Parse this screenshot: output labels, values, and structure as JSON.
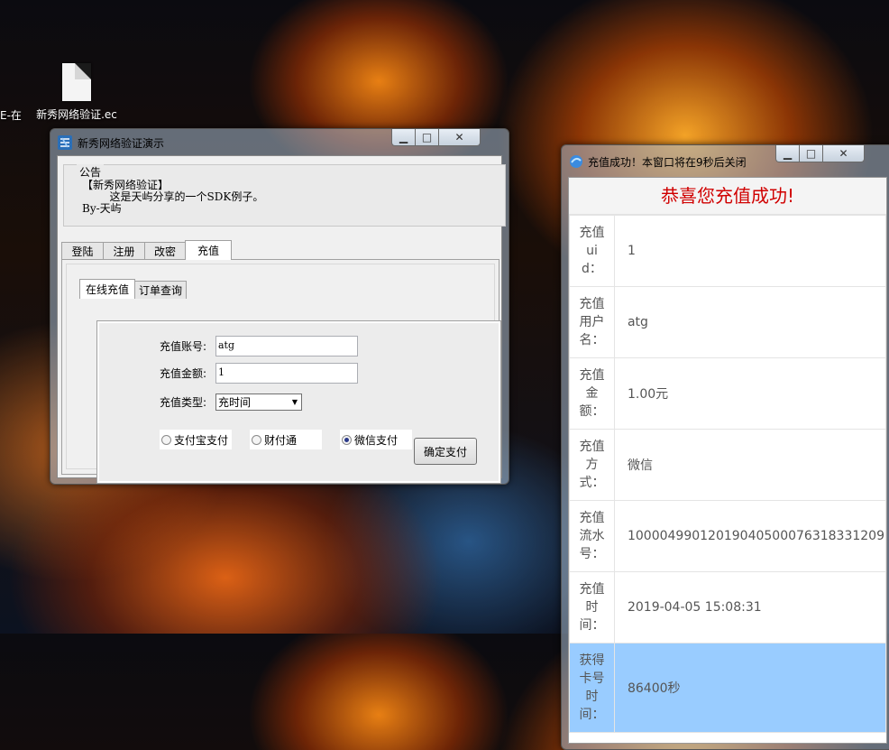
{
  "desktop": {
    "icon_label": "新秀网络验证.ec",
    "left_partial_label": "E-在"
  },
  "left_window": {
    "title": "新秀网络验证演示",
    "notice": {
      "legend": "公告",
      "text": "【新秀网络验证】\n        这是天屿分享的一个SDK例子。\nBy-天屿"
    },
    "tabs": [
      "登陆",
      "注册",
      "改密",
      "充值"
    ],
    "active_tab": "充值",
    "sub_tabs": [
      "在线充值",
      "订单查询"
    ],
    "active_sub_tab": "在线充值",
    "form": {
      "account_label": "充值账号:",
      "account_value": "atg",
      "amount_label": "充值金额:",
      "amount_value": "1",
      "type_label": "充值类型:",
      "type_value": "充时间"
    },
    "payment_options": [
      {
        "label": "支付宝支付",
        "selected": false
      },
      {
        "label": "财付通",
        "selected": false
      },
      {
        "label": "微信支付",
        "selected": true
      }
    ],
    "confirm_button": "确定支付"
  },
  "right_window": {
    "title": "充值成功！本窗口将在9秒后关闭",
    "heading": "恭喜您充值成功!",
    "heading_color": "#d00000",
    "rows": [
      {
        "key": "充值uid：",
        "value": "1"
      },
      {
        "key": "充值用户名：",
        "value": "atg"
      },
      {
        "key": "充值金额：",
        "value": "1.00元"
      },
      {
        "key": "充值方式：",
        "value": "微信"
      },
      {
        "key": "充值流水号：",
        "value": "10000499012019040500076318331209"
      },
      {
        "key": "充值时间：",
        "value": "2019-04-05 15:08:31"
      },
      {
        "key": "获得卡号时间：",
        "value": "86400秒",
        "highlight": true
      }
    ],
    "highlight_color": "#99ccff"
  },
  "window_buttons": {
    "minimize": "▁",
    "maximize": "□",
    "close": "✕"
  }
}
